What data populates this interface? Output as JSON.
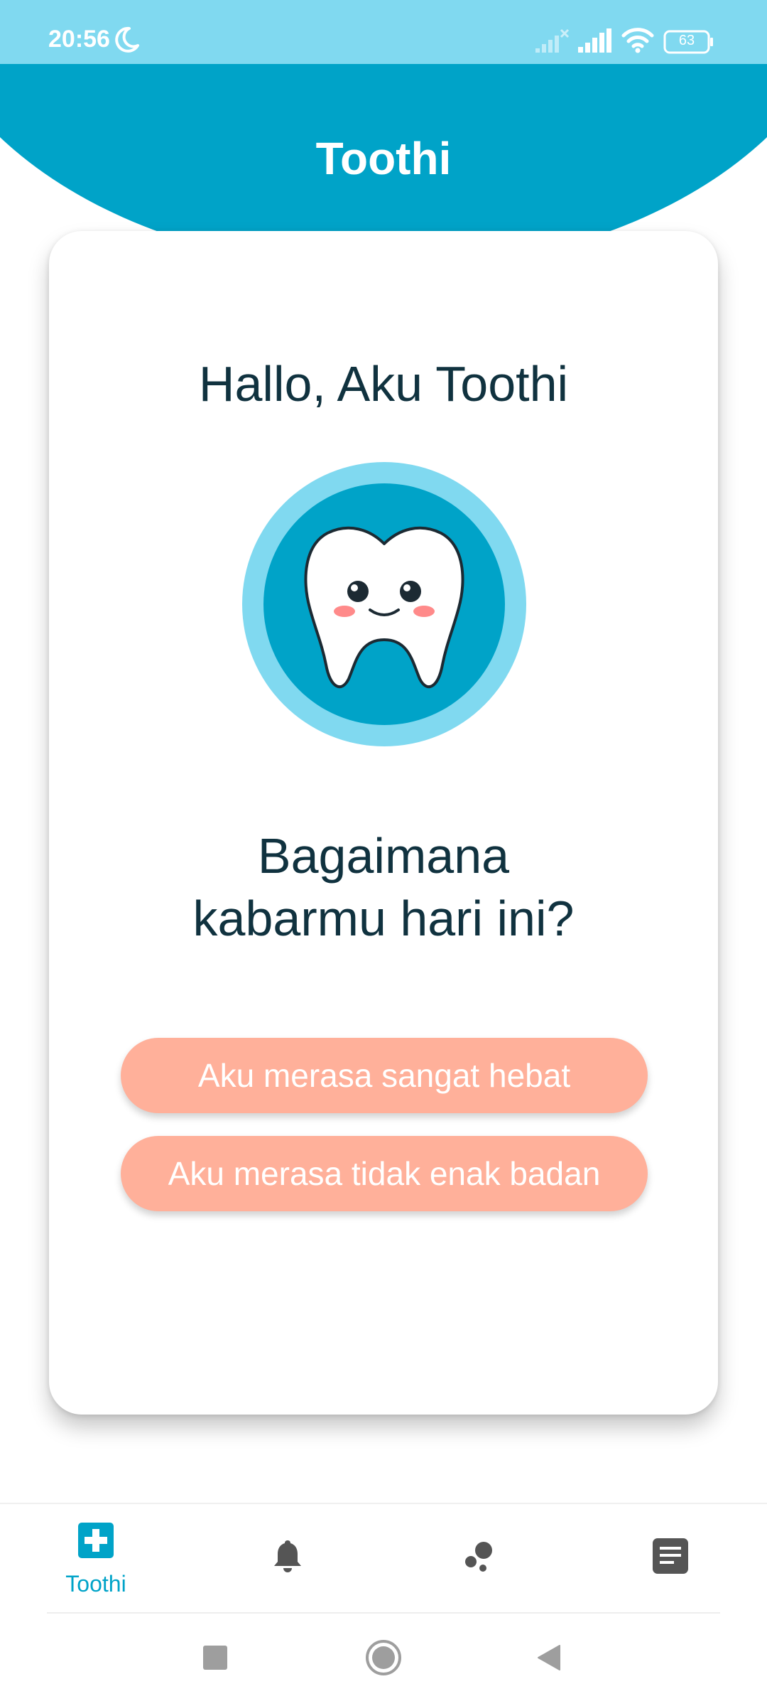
{
  "status_bar": {
    "time": "20:56",
    "battery": "63"
  },
  "header": {
    "title": "Toothi"
  },
  "card": {
    "greeting": "Hallo, Aku Toothi",
    "question_line1": "Bagaimana",
    "question_line2": "kabarmu hari ini?",
    "buttons": [
      {
        "label": "Aku merasa sangat hebat"
      },
      {
        "label": "Aku merasa tidak enak badan"
      }
    ]
  },
  "bottom_nav": {
    "items": [
      {
        "label": "Toothi",
        "icon": "medical-plus-icon",
        "active": true
      },
      {
        "label": "",
        "icon": "bell-icon",
        "active": false
      },
      {
        "label": "",
        "icon": "bubbles-icon",
        "active": false
      },
      {
        "label": "",
        "icon": "notes-icon",
        "active": false
      }
    ]
  },
  "colors": {
    "status_bar": "#80d9f0",
    "header": "#00a3c8",
    "text_dark": "#10323f",
    "button": "#ffb09a",
    "nav_active": "#00a3c8",
    "nav_inactive": "#555555"
  }
}
